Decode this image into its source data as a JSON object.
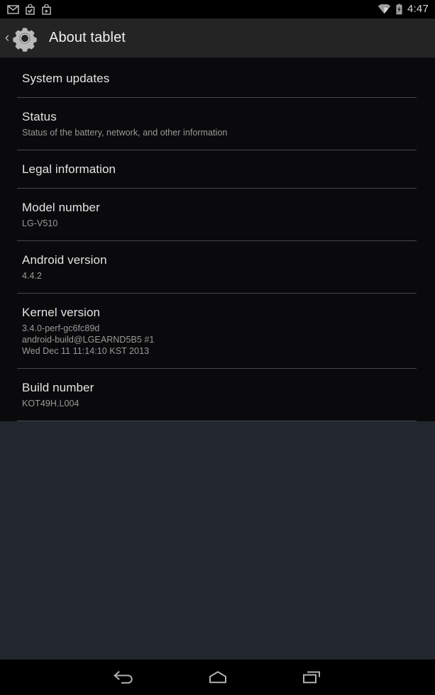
{
  "status_bar": {
    "icons_left": [
      {
        "name": "email-icon",
        "label": "Email"
      },
      {
        "name": "play-store-update-icon",
        "label": "Play Store update"
      },
      {
        "name": "play-store-icon",
        "label": "Play Store"
      }
    ],
    "icons_right": [
      {
        "name": "wifi-icon",
        "label": "Wi-Fi"
      },
      {
        "name": "battery-charging-icon",
        "label": "Battery charging"
      }
    ],
    "clock": "4:47"
  },
  "action_bar": {
    "up_chevron": "‹",
    "icon": "settings-gear-icon",
    "title": "About tablet"
  },
  "preferences": [
    {
      "name": "system-updates",
      "title": "System updates",
      "summary": []
    },
    {
      "name": "status",
      "title": "Status",
      "summary": [
        "Status of the battery, network, and other information"
      ]
    },
    {
      "name": "legal-information",
      "title": "Legal information",
      "summary": []
    },
    {
      "name": "model-number",
      "title": "Model number",
      "summary": [
        "LG-V510"
      ]
    },
    {
      "name": "android-version",
      "title": "Android version",
      "summary": [
        "4.4.2"
      ]
    },
    {
      "name": "kernel-version",
      "title": "Kernel version",
      "summary": [
        "3.4.0-perf-gc6fc89d",
        "android-build@LGEARND5B5 #1",
        "Wed Dec 11 11:14:10 KST 2013"
      ]
    },
    {
      "name": "build-number",
      "title": "Build number",
      "summary": [
        "KOT49H.L004"
      ]
    }
  ],
  "nav_bar": {
    "back": "back-icon",
    "home": "home-icon",
    "recents": "recent-apps-icon"
  },
  "colors": {
    "status_bar_bg": "#000000",
    "action_bar_bg": "#242424",
    "list_bg": "#0a0a0c",
    "page_bg": "#22262d",
    "divider": "#43474c",
    "title_text": "#e4e4e4",
    "summary_text": "#9a9a9a",
    "nav_bar_bg": "#000000",
    "nav_icon": "#b0b0b0"
  }
}
